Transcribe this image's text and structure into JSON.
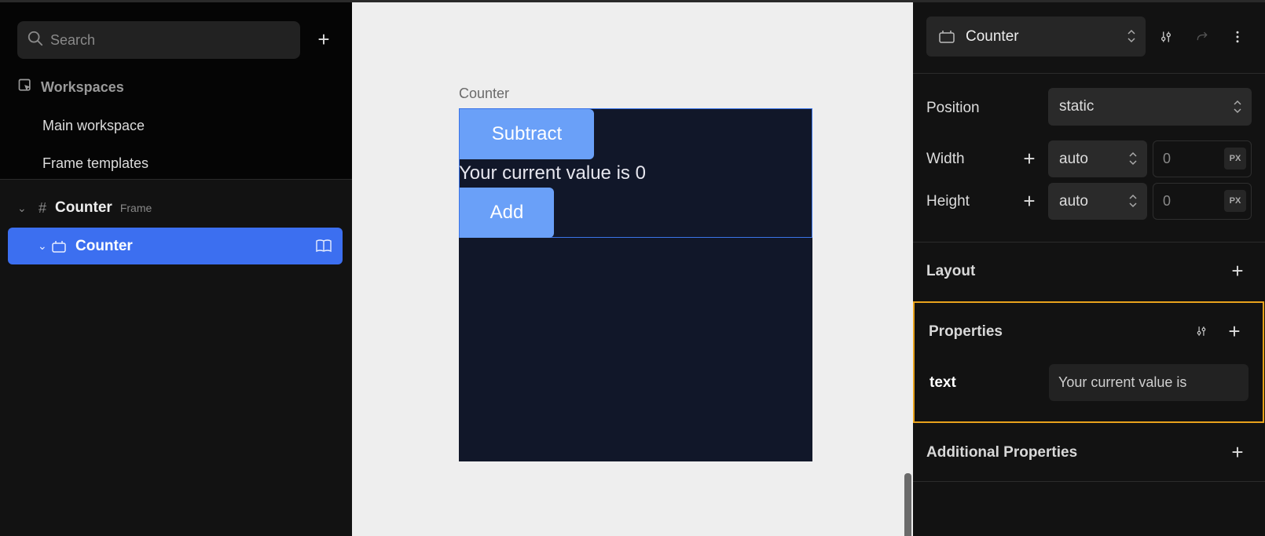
{
  "left": {
    "search_placeholder": "Search",
    "workspaces_title": "Workspaces",
    "workspace_items": [
      "Main workspace",
      "Frame templates"
    ],
    "tree": {
      "frame_name": "Counter",
      "frame_tag": "Frame",
      "selected_component": "Counter"
    }
  },
  "canvas": {
    "frame_label": "Counter",
    "subtract_label": "Subtract",
    "value_text": "Your current value is 0",
    "add_label": "Add"
  },
  "right": {
    "component_name": "Counter",
    "position_label": "Position",
    "position_value": "static",
    "width_label": "Width",
    "width_mode": "auto",
    "width_value": "0",
    "height_label": "Height",
    "height_mode": "auto",
    "height_value": "0",
    "unit": "PX",
    "layout_title": "Layout",
    "properties_title": "Properties",
    "prop_text_name": "text",
    "prop_text_value": "Your current value is",
    "additional_title": "Additional Properties"
  },
  "colors": {
    "accent": "#3c6ff0",
    "button": "#6aa0f8",
    "frame_bg": "#111729",
    "highlight": "#e8a21c"
  }
}
